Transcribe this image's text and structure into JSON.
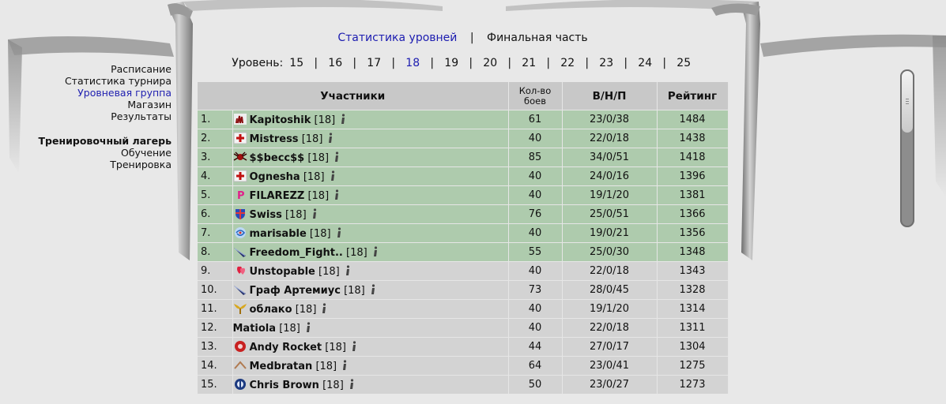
{
  "menu": {
    "items": [
      "Расписание",
      "Статистика турнира",
      "Уровневая группа",
      "Магазин",
      "Результаты"
    ],
    "active_index": 2,
    "section_title": "Тренировочный лагерь",
    "section_items": [
      "Обучение",
      "Тренировка"
    ]
  },
  "nav": {
    "level_stats": "Статистика уровней",
    "separator": "|",
    "final_part": "Финальная часть"
  },
  "levels": {
    "label": "Уровень:",
    "values": [
      "15",
      "16",
      "17",
      "18",
      "19",
      "20",
      "21",
      "22",
      "23",
      "24",
      "25"
    ],
    "current": "18"
  },
  "table": {
    "headers": {
      "participants": "Участники",
      "battles_line1": "Кол-во",
      "battles_line2": "боев",
      "wdl": "В/Н/П",
      "rating": "Рейтинг"
    },
    "rows": [
      {
        "n": "1.",
        "icon": "claw-icon",
        "name": "Kapitoshik",
        "level": "[18]",
        "battles": "61",
        "wdl": "23/0/38",
        "rating": "1484",
        "top": true
      },
      {
        "n": "2.",
        "icon": "red-cross-icon",
        "name": "Mistress",
        "level": "[18]",
        "battles": "40",
        "wdl": "22/0/18",
        "rating": "1438",
        "top": true
      },
      {
        "n": "3.",
        "icon": "spider-icon",
        "name": "$$becc$$",
        "level": "[18]",
        "battles": "85",
        "wdl": "34/0/51",
        "rating": "1418",
        "top": true
      },
      {
        "n": "4.",
        "icon": "red-cross-icon",
        "name": "Ognesha",
        "level": "[18]",
        "battles": "40",
        "wdl": "24/0/16",
        "rating": "1396",
        "top": true
      },
      {
        "n": "5.",
        "icon": "pink-p-icon",
        "name": "FILAREZZ",
        "level": "[18]",
        "battles": "40",
        "wdl": "19/1/20",
        "rating": "1381",
        "top": true
      },
      {
        "n": "6.",
        "icon": "shield-icon",
        "name": "Swiss",
        "level": "[18]",
        "battles": "76",
        "wdl": "25/0/51",
        "rating": "1366",
        "top": true
      },
      {
        "n": "7.",
        "icon": "swirl-icon",
        "name": "marisable",
        "level": "[18]",
        "battles": "40",
        "wdl": "19/0/21",
        "rating": "1356",
        "top": true
      },
      {
        "n": "8.",
        "icon": "blade-icon",
        "name": "Freedom_Fight..",
        "level": "[18]",
        "battles": "55",
        "wdl": "25/0/30",
        "rating": "1348",
        "top": true
      },
      {
        "n": "9.",
        "icon": "hearts-icon",
        "name": "Unstopable",
        "level": "[18]",
        "battles": "40",
        "wdl": "22/0/18",
        "rating": "1343",
        "top": false
      },
      {
        "n": "10.",
        "icon": "blade-icon",
        "name": "Граф Артемиус",
        "level": "[18]",
        "battles": "73",
        "wdl": "28/0/45",
        "rating": "1328",
        "top": false
      },
      {
        "n": "11.",
        "icon": "wings-icon",
        "name": "облако",
        "level": "[18]",
        "battles": "40",
        "wdl": "19/1/20",
        "rating": "1314",
        "top": false
      },
      {
        "n": "12.",
        "icon": "",
        "name": "Matiola",
        "level": "[18]",
        "battles": "40",
        "wdl": "22/0/18",
        "rating": "1311",
        "top": false
      },
      {
        "n": "13.",
        "icon": "red-shield-icon",
        "name": "Andy Rocket",
        "level": "[18]",
        "battles": "44",
        "wdl": "27/0/17",
        "rating": "1304",
        "top": false
      },
      {
        "n": "14.",
        "icon": "chevron-icon",
        "name": "Medbratan",
        "level": "[18]",
        "battles": "64",
        "wdl": "23/0/41",
        "rating": "1275",
        "top": false
      },
      {
        "n": "15.",
        "icon": "blue-emblem-icon",
        "name": "Chris Brown",
        "level": "[18]",
        "battles": "50",
        "wdl": "23/0/27",
        "rating": "1273",
        "top": false
      }
    ]
  }
}
